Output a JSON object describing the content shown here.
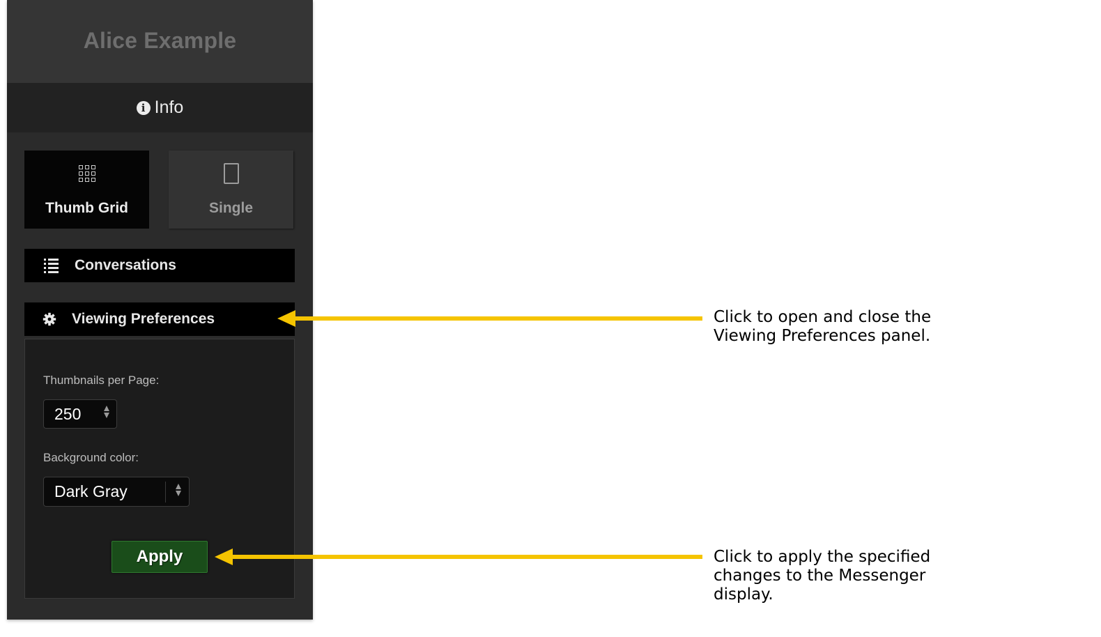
{
  "sidebar": {
    "header_title": "Alice Example",
    "info_label": "Info",
    "view_modes": [
      {
        "label": "Thumb Grid",
        "icon": "grid-icon",
        "selected": true
      },
      {
        "label": "Single",
        "icon": "single-page-icon",
        "selected": false
      }
    ],
    "conversations_label": "Conversations",
    "preferences_label": "Viewing Preferences",
    "preferences": {
      "thumbnails_label": "Thumbnails per Page:",
      "thumbnails_value": "250",
      "background_label": "Background color:",
      "background_value": "Dark Gray",
      "apply_label": "Apply"
    }
  },
  "annotations": {
    "preferences_note": "Click to open and close the Viewing Preferences panel.",
    "apply_note": "Click to apply the specified changes to the Messenger display."
  },
  "colors": {
    "sidebar_bg": "#2b2b2b",
    "callout_arrow": "#f5c400",
    "apply_button": "#1a4d1a"
  }
}
